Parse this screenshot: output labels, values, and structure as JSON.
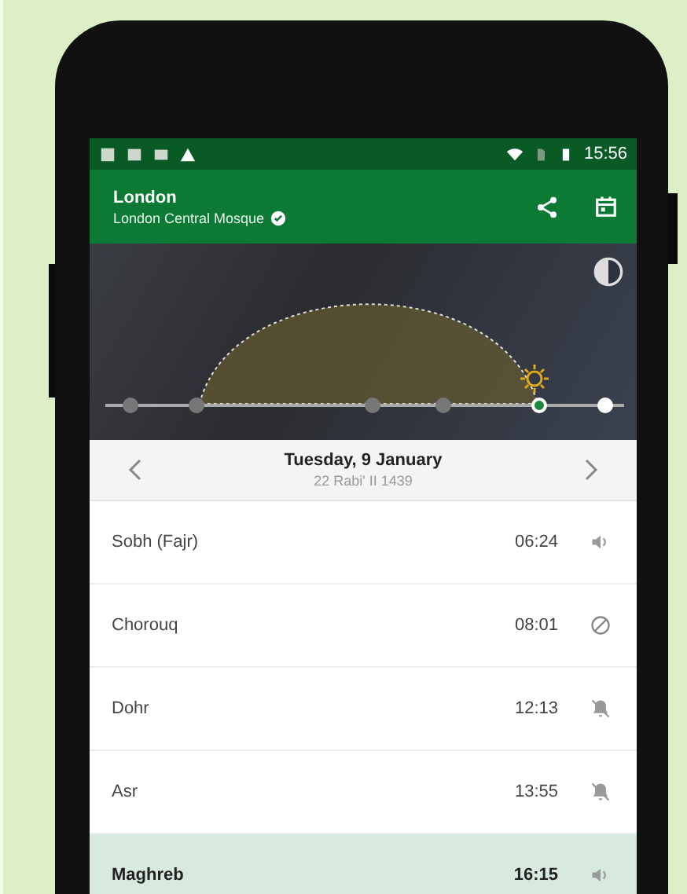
{
  "status_bar": {
    "time": "15:56"
  },
  "app_bar": {
    "title": "London",
    "subtitle": "London Central Mosque",
    "verified": true
  },
  "date_bar": {
    "date": "Tuesday, 9 January",
    "hijri": "22 Rabi' II 1439"
  },
  "prayers": [
    {
      "name": "Sobh (Fajr)",
      "time": "06:24",
      "kind": "sound",
      "selected": false
    },
    {
      "name": "Chorouq",
      "time": "08:01",
      "kind": "off",
      "selected": false
    },
    {
      "name": "Dohr",
      "time": "12:13",
      "kind": "muted",
      "selected": false
    },
    {
      "name": "Asr",
      "time": "13:55",
      "kind": "muted",
      "selected": false
    },
    {
      "name": "Maghreb",
      "time": "16:15",
      "kind": "sound",
      "selected": true
    }
  ]
}
